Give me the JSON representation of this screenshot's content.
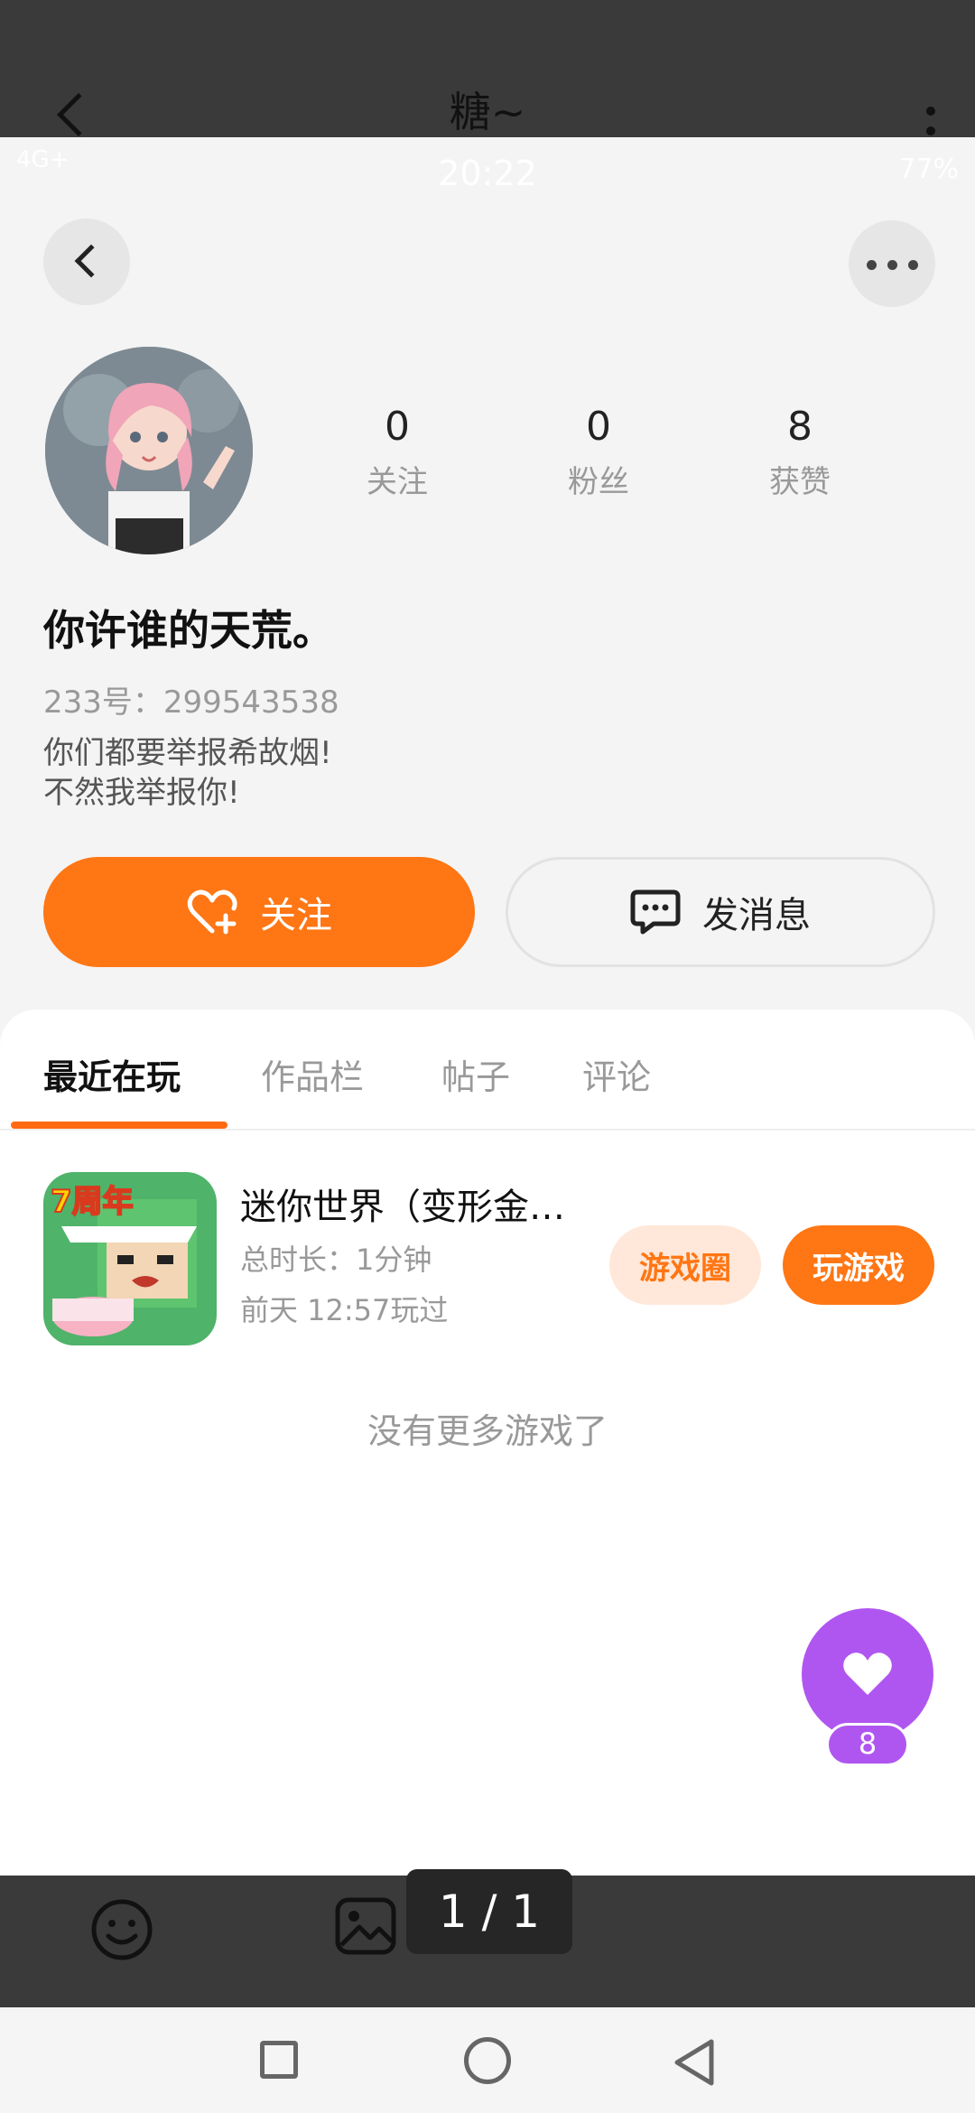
{
  "viewer": {
    "title": "糖~",
    "page_indicator": "1 / 1"
  },
  "status_bar": {
    "signal": "4G+",
    "time": "20:22",
    "battery": "77%"
  },
  "profile": {
    "nickname": "你许谁的天荒。",
    "uid": "233号：299543538",
    "bio_line1": "你们都要举报希故烟!",
    "bio_line2": "不然我举报你!",
    "stats": [
      {
        "value": "0",
        "label": "关注"
      },
      {
        "value": "0",
        "label": "粉丝"
      },
      {
        "value": "8",
        "label": "获赞"
      }
    ],
    "follow_label": "关注",
    "message_label": "发消息"
  },
  "tabs": [
    {
      "label": "最近在玩",
      "active": true
    },
    {
      "label": "作品栏",
      "active": false
    },
    {
      "label": "帖子",
      "active": false
    },
    {
      "label": "评论",
      "active": false
    }
  ],
  "games": [
    {
      "title": "迷你世界（变形金…",
      "duration": "总时长：1分钟",
      "last_played": "前天 12:57玩过",
      "circle_label": "游戏圈",
      "play_label": "玩游戏",
      "badge": "7周年"
    }
  ],
  "empty_hint": "没有更多游戏了",
  "likes": {
    "count": "8"
  },
  "colors": {
    "accent": "#ff7614",
    "like_purple": "#b056f0",
    "header_dark": "#3a3a3a"
  },
  "icons": [
    "back-icon",
    "more-icon",
    "heart-plus-icon",
    "chat-icon",
    "heart-icon",
    "emoji-icon",
    "image-icon",
    "nav-recent-icon",
    "nav-home-icon",
    "nav-back-icon"
  ]
}
